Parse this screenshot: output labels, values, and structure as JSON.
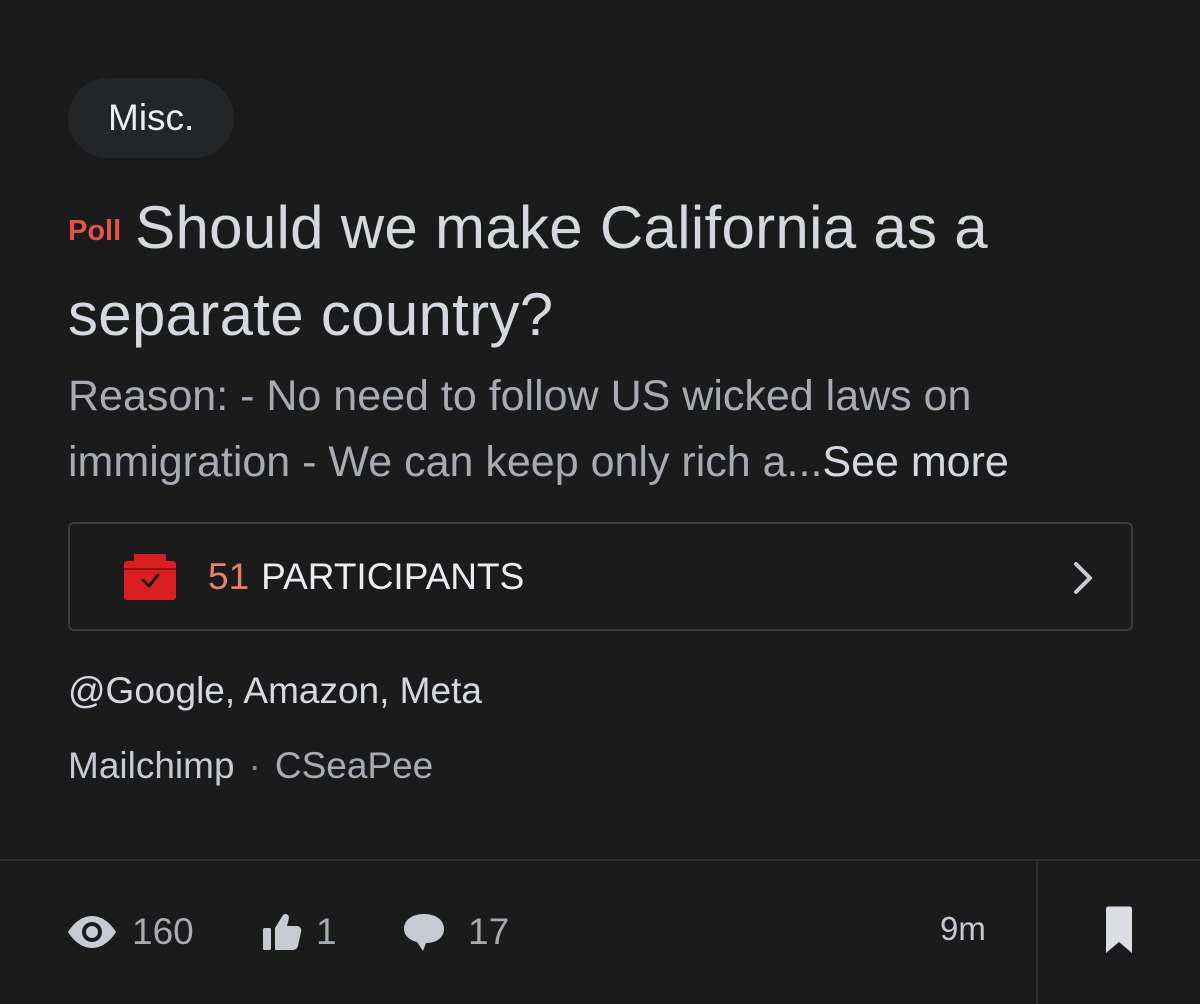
{
  "post": {
    "category": "Misc.",
    "badge": "Poll",
    "title": "Should we make California as a separate country?",
    "body_preview": "Reason:  - No need to follow US wicked laws on immigration  - We can keep only rich a...",
    "see_more_label": "See more",
    "participants": {
      "count": "51",
      "label": "PARTICIPANTS"
    },
    "mentions": "@Google, Amazon, Meta",
    "company": "Mailchimp",
    "separator": "·",
    "author": "CSeaPee"
  },
  "footer": {
    "views": "160",
    "likes": "1",
    "comments": "17",
    "time_ago": "9m"
  },
  "colors": {
    "background": "#1b1b1c",
    "poll_badge": "#e1544a",
    "participants_count": "#e9806f",
    "ballot_icon": "#d91f1f"
  },
  "icons": {
    "views": "eye-icon",
    "likes": "thumbs-up-icon",
    "comments": "comment-bubble-icon",
    "participants": "ballot-box-icon",
    "open": "chevron-right-icon",
    "save": "bookmark-icon"
  }
}
